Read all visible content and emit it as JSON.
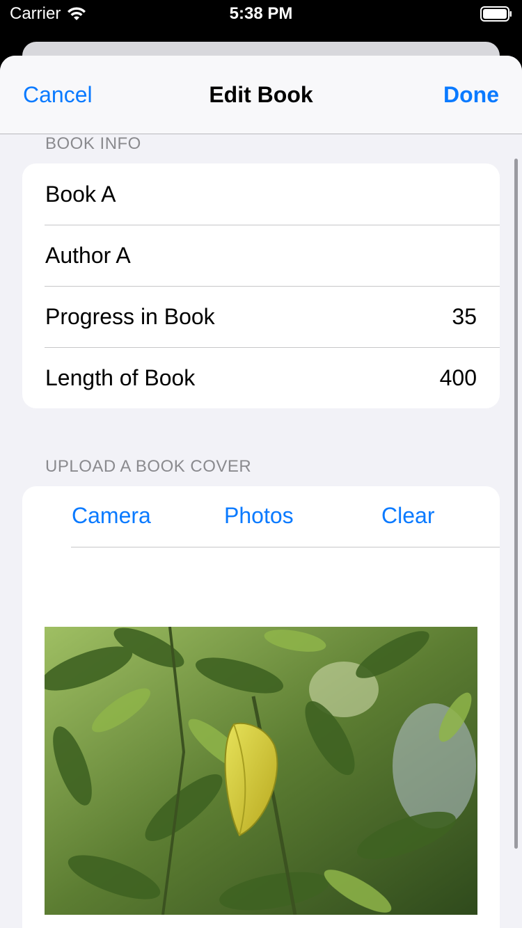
{
  "status_bar": {
    "carrier": "Carrier",
    "time": "5:38 PM"
  },
  "nav": {
    "cancel_label": "Cancel",
    "title": "Edit Book",
    "done_label": "Done"
  },
  "book_info": {
    "header": "BOOK INFO",
    "title_value": "Book A",
    "author_value": "Author A",
    "progress_label": "Progress in Book",
    "progress_value": "35",
    "length_label": "Length of Book",
    "length_value": "400"
  },
  "cover": {
    "header": "UPLOAD A BOOK COVER",
    "camera_label": "Camera",
    "photos_label": "Photos",
    "clear_label": "Clear"
  },
  "colors": {
    "accent": "#0a7aff",
    "background": "#f2f2f7",
    "secondary_text": "#8a8a8e"
  }
}
